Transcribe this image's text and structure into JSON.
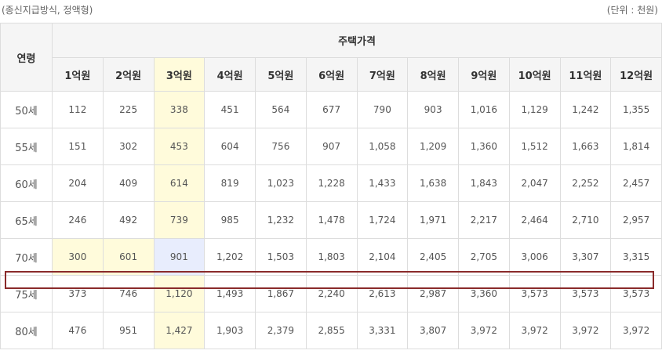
{
  "caption_left": "(종신지급방식, 정액형)",
  "caption_right": "(단위 : 천원)",
  "table": {
    "age_header": "연령",
    "group_header": "주택가격",
    "price_headers": [
      "1억원",
      "2억원",
      "3억원",
      "4억원",
      "5억원",
      "6억원",
      "7억원",
      "8억원",
      "9억원",
      "10억원",
      "11억원",
      "12억원"
    ],
    "rows": [
      {
        "age": "50세",
        "values": [
          "112",
          "225",
          "338",
          "451",
          "564",
          "677",
          "790",
          "903",
          "1,016",
          "1,129",
          "1,242",
          "1,355"
        ]
      },
      {
        "age": "55세",
        "values": [
          "151",
          "302",
          "453",
          "604",
          "756",
          "907",
          "1,058",
          "1,209",
          "1,360",
          "1,512",
          "1,663",
          "1,814"
        ]
      },
      {
        "age": "60세",
        "values": [
          "204",
          "409",
          "614",
          "819",
          "1,023",
          "1,228",
          "1,433",
          "1,638",
          "1,843",
          "2,047",
          "2,252",
          "2,457"
        ]
      },
      {
        "age": "65세",
        "values": [
          "246",
          "492",
          "739",
          "985",
          "1,232",
          "1,478",
          "1,724",
          "1,971",
          "2,217",
          "2,464",
          "2,710",
          "2,957"
        ]
      },
      {
        "age": "70세",
        "values": [
          "300",
          "601",
          "901",
          "1,202",
          "1,503",
          "1,803",
          "2,104",
          "2,405",
          "2,705",
          "3,006",
          "3,307",
          "3,315"
        ]
      },
      {
        "age": "75세",
        "values": [
          "373",
          "746",
          "1,120",
          "1,493",
          "1,867",
          "2,240",
          "2,613",
          "2,987",
          "3,360",
          "3,573",
          "3,573",
          "3,573"
        ]
      },
      {
        "age": "80세",
        "values": [
          "476",
          "951",
          "1,427",
          "1,903",
          "2,379",
          "2,855",
          "3,331",
          "3,807",
          "3,972",
          "3,972",
          "3,972",
          "3,972"
        ]
      }
    ],
    "highlighted_column": "3억원",
    "highlighted_row": "70세"
  },
  "colors": {
    "header_bg": "#f5f5f5",
    "highlight_yellow": "#fffbdb",
    "highlight_blue": "#e8edfd",
    "row_frame": "#8a2a2a",
    "border": "#dddddd"
  }
}
